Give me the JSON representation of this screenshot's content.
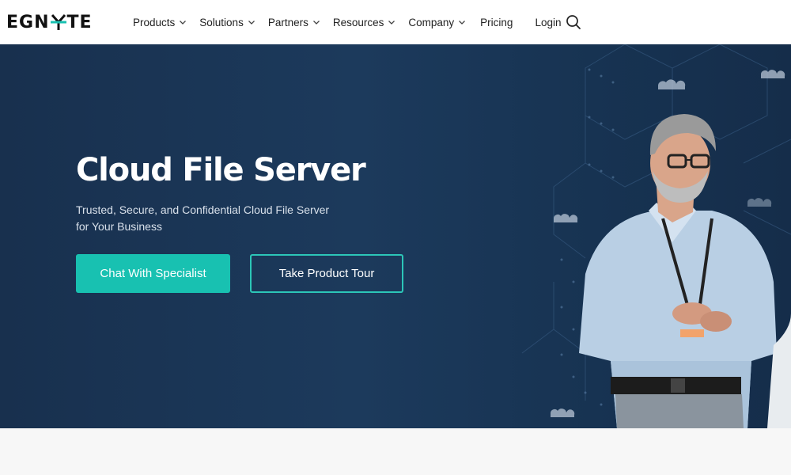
{
  "nav": {
    "logo_text_left": "EGN",
    "logo_text_right": "TE",
    "items": [
      {
        "label": "Products"
      },
      {
        "label": "Solutions"
      },
      {
        "label": "Partners"
      },
      {
        "label": "Resources"
      },
      {
        "label": "Company"
      }
    ],
    "pricing": "Pricing",
    "login": "Login",
    "search_icon": "search-icon"
  },
  "hero": {
    "title": "Cloud File Server",
    "subtitle": "Trusted, Secure, and Confidential Cloud File Server for Your Business",
    "primary_button": "Chat With Specialist",
    "secondary_button": "Take Product Tour"
  },
  "colors": {
    "hero_bg": "#1c3a5c",
    "accent": "#18c1b1",
    "nav_bg": "#ffffff"
  }
}
